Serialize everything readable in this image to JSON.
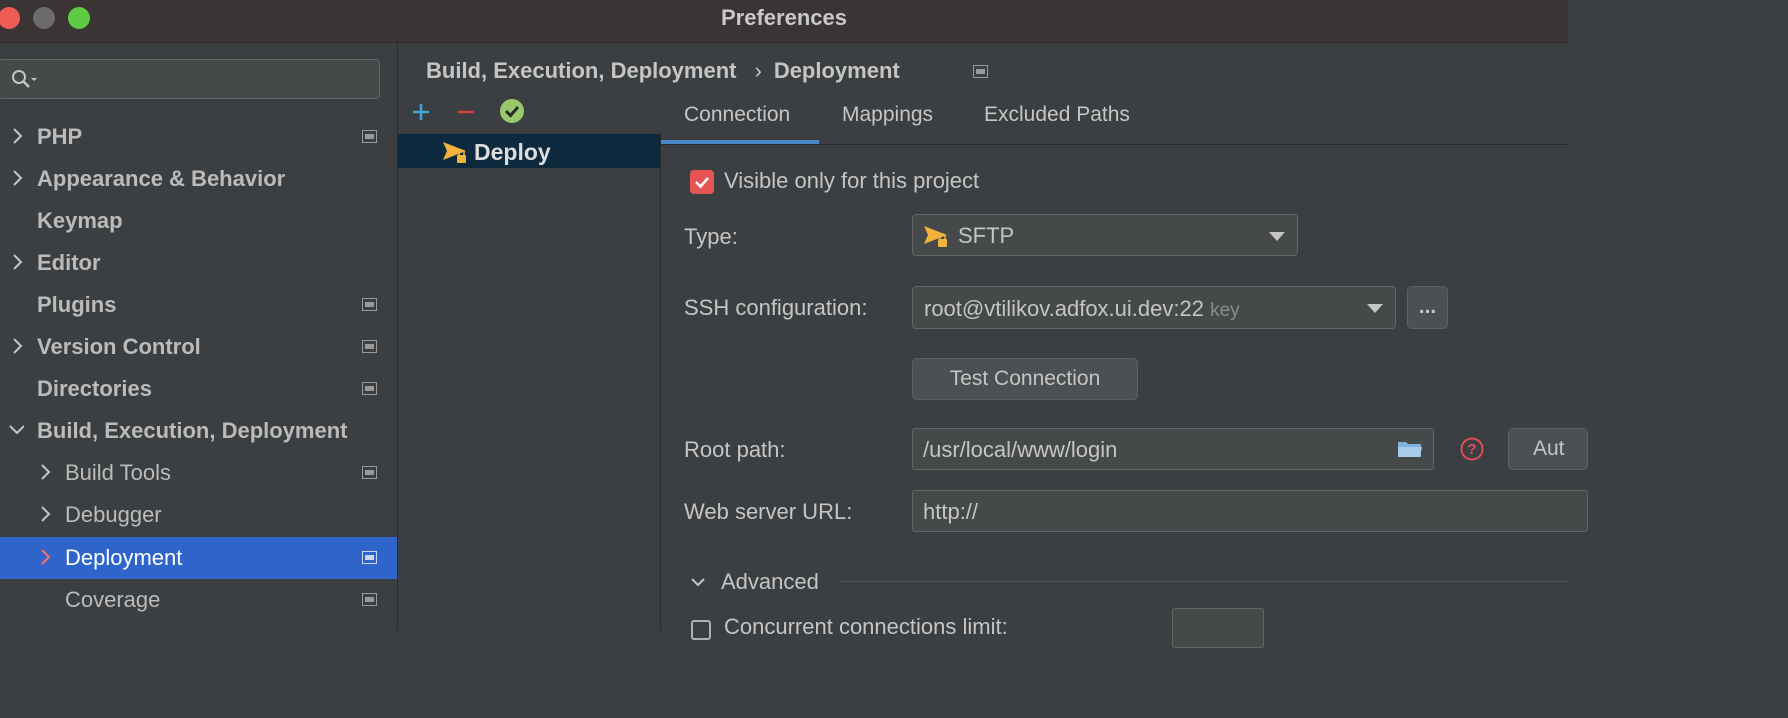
{
  "window": {
    "title": "Preferences"
  },
  "sidebar": {
    "items": [
      {
        "label": "PHP",
        "expandable": true,
        "badge": true
      },
      {
        "label": "Appearance & Behavior",
        "expandable": true,
        "badge": false
      },
      {
        "label": "Keymap",
        "expandable": false,
        "badge": false
      },
      {
        "label": "Editor",
        "expandable": true,
        "badge": false
      },
      {
        "label": "Plugins",
        "expandable": false,
        "badge": true
      },
      {
        "label": "Version Control",
        "expandable": true,
        "badge": true
      },
      {
        "label": "Directories",
        "expandable": false,
        "badge": true
      },
      {
        "label": "Build, Execution, Deployment",
        "expandable": true,
        "expanded": true,
        "badge": false
      },
      {
        "label": "Build Tools",
        "expandable": true,
        "badge": true
      },
      {
        "label": "Debugger",
        "expandable": true,
        "badge": false
      },
      {
        "label": "Deployment",
        "expandable": true,
        "badge": true,
        "selected": true
      },
      {
        "label": "Coverage",
        "expandable": false,
        "badge": true
      }
    ]
  },
  "breadcrumb": {
    "parent": "Build, Execution, Deployment",
    "separator": "›",
    "current": "Deployment"
  },
  "servers": {
    "items": [
      {
        "name": "Deploy",
        "selected": true
      }
    ]
  },
  "tabs": [
    {
      "label": "Connection",
      "active": true
    },
    {
      "label": "Mappings",
      "active": false
    },
    {
      "label": "Excluded Paths",
      "active": false
    }
  ],
  "connection": {
    "visible_only_label": "Visible only for this project",
    "visible_only_checked": true,
    "type_label": "Type:",
    "type_value": "SFTP",
    "ssh_label": "SSH configuration:",
    "ssh_value": "root@vtilikov.adfox.ui.dev:22",
    "ssh_hint": "key",
    "ssh_more": "...",
    "test_button": "Test Connection",
    "root_label": "Root path:",
    "root_value": "/usr/local/www/login",
    "autodetect_button": "Aut",
    "web_label": "Web server URL:",
    "web_value": "http://",
    "advanced_label": "Advanced",
    "concurrent_label": "Concurrent connections limit:"
  },
  "colors": {
    "selection": "#2f65ca",
    "server_selection": "#0d293e",
    "checkbox": "#e45554",
    "add": "#3ea7d8",
    "remove": "#d4443c",
    "check": "#9ac96c",
    "sftp": "#f2b33c",
    "tab_underline": "#4a88c7"
  }
}
